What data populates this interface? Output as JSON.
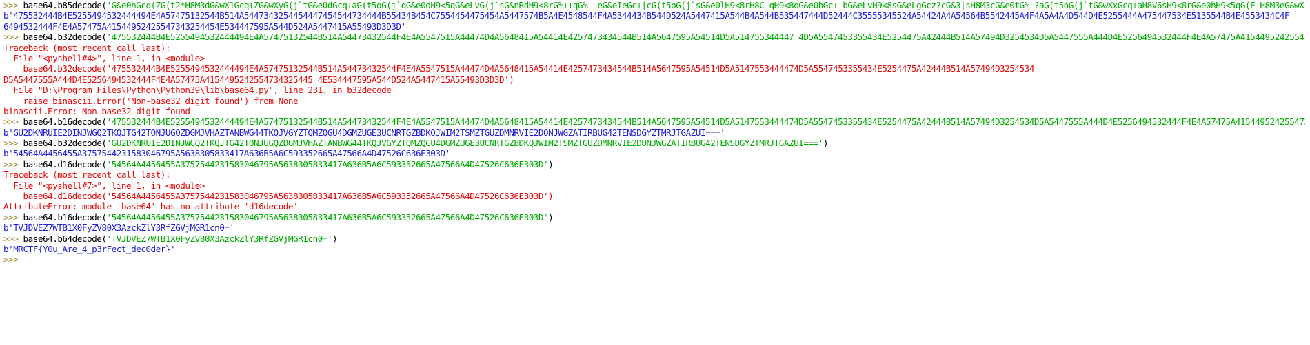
{
  "window": {
    "type": "python-idle-shell"
  },
  "colors": {
    "prompt": "#9e8a2c",
    "code": "#000000",
    "string": "#00aa00",
    "output": "#1f1fd4",
    "error": "#e10b0b",
    "background": "#ffffff"
  },
  "shell": {
    "prompt": ">>> ",
    "lines": [
      {
        "kind": "input",
        "code": "base64.b85decode(",
        "str": "'G&e0hGcq(ZG(t2*H8M3dG&wX1Gcq(ZG&wXyG(j`tG&e0dGcq+aG(t5oG(j`qG&e0dH9<5qG&eLvG(j`sG&nRdH9<8rG%++qG%__eG&eIeGc+|cG(t5oG(j`sG&e0lH9<8rH8C_qH9<8oG&e0hGc+_bG&eLvH9<8sG&eLgGcz?cG&3|sH8M3cG&e0tG%_?aG(t5oG(j`tG&wXxGcq+aH8V6sH9<8rG&e0hH9<5qG(E-H8M3eG&wX1Gcq(ZG)6Q<G(j`qG&e0tG%*<aG&wagG%__cG&eIeGcq+aG&M9uH8V6cG&e01H9<8rG(<HrG(j`qG&eLcH9<8sG&wUwGek2'",
        "close": ")"
      },
      {
        "kind": "output",
        "text": "b'475532444B4E5255494532444494E4A57475132544B514A5447343254454447454544734444B55434B454C7554454475454A5447574B5A4E4548544F4A5344434B544D524A5447415A544B4A544B535447444D52444C35555345524A54424A4A54564B5542445A4F4A5A4A4D544D4E5255444A475447534E5135544B4E4553434C4F"
      },
      {
        "kind": "output",
        "text": "6494532444F4E4A57475A41544952425547343254454E534447595A544D524A5447415A55493D3D3D'"
      },
      {
        "kind": "input",
        "code": "base64.b32decode(",
        "str": "'475532444B4E5255494532444494E4A57475132544B514A54473432544F4E4A5547515A44474D4A5648415A54414E4257473434544B514A5647595A54514D5A514755344447 4D5A5547453355434E5254475A42444B514A57494D3254534D5A5447555A444D4E5256494532444F4E4A57475A4154495242554734325445 4E534447595A544D524A5447415A55493D3D3D'",
        "close": ")"
      },
      {
        "kind": "error",
        "text": "Traceback (most recent call last):"
      },
      {
        "kind": "error",
        "text": "  File \"<pyshell#4>\", line 1, in <module>"
      },
      {
        "kind": "error",
        "text": "    base64.b32decode('475532444B4E5255494532444494E4A57475132544B514A54473432544F4E4A5547515A44474D4A5648415A54414E4257473434544B514A5647595A54514D5A5147553444474D5A5547453355434E5254475A42444B514A57494D3254534"
      },
      {
        "kind": "error",
        "text": "D5A5447555A444D4E5256494532444F4E4A57475A4154495242554734325445 4E534447595A544D524A5447415A55493D3D3D')"
      },
      {
        "kind": "error",
        "text": "  File \"D:\\Program Files\\Python\\Python39\\lib\\base64.py\", line 231, in b32decode"
      },
      {
        "kind": "error",
        "text": "    raise binascii.Error('Non-base32 digit found') from None"
      },
      {
        "kind": "error",
        "text": "binascii.Error: Non-base32 digit found"
      },
      {
        "kind": "input",
        "code": "base64.b16decode(",
        "str": "'475532444B4E5255494532444494E4A57475132544B514A54473432544F4E4A5547515A44474D4A5648415A54414E4257473434544B514A5647595A54514D5A5147553444474D5A5547453355434E5254475A42444B514A57494D3254534D5A5447555A444D4E5256494532444F4E4A57475A415449524255473432544554E534447595A544D524A5447415A55493D3D3D'",
        "close": ")"
      },
      {
        "kind": "output",
        "text": "b'GU2DKNRUIE2DINJWGQ2TKQJTG42TONJUGQZDGMJVHAZTANBWG44TKQJVGYZTQMZQGU4DGMZUGE3UCNRTGZBDKQJWIM2TSMZTGUZDMNRVIE2DONJWGZATIRBUG42TENSDGYZTMRJTGAZUI==='"
      },
      {
        "kind": "input",
        "code": "base64.b32decode(",
        "str": "'GU2DKNRUIE2DINJWGQ2TKQJTG42TONJUGQZDGMJVHAZTANBWG44TKQJVGYZTQMZQGU4DGMZUGE3UCNRTGZBDKQJWIM2TSMZTGUZDMNRVIE2DONJWGZATIRBUG42TENSDGYZTMRJTGAZUI==='",
        "close": ")"
      },
      {
        "kind": "output",
        "text": "b'54564A4456455A3757544231583046795A5638305833417A636B5A6C593352665A47566A4D47526C636E303D'"
      },
      {
        "kind": "input",
        "code": "base64.d16decode(",
        "str": "'54564A4456455A3757544231583046795A5638305833417A636B5A6C593352665A47566A4D47526C636E303D'",
        "close": ")"
      },
      {
        "kind": "error",
        "text": "Traceback (most recent call last):"
      },
      {
        "kind": "error",
        "text": "  File \"<pyshell#7>\", line 1, in <module>"
      },
      {
        "kind": "error",
        "text": "    base64.d16decode('54564A4456455A3757544231583046795A5638305833417A636B5A6C593352665A47566A4D47526C636E303D')"
      },
      {
        "kind": "error",
        "text": "AttributeError: module 'base64' has no attribute 'd16decode'"
      },
      {
        "kind": "input",
        "code": "base64.b16decode(",
        "str": "'54564A4456455A3757544231583046795A5638305833417A636B5A6C593352665A47566A4D47526C636E303D'",
        "close": ")"
      },
      {
        "kind": "output",
        "text": "b'TVJDVEZ7WTB1X0FyZV80X3AzckZlY3RfZGVjMGR1cn0='"
      },
      {
        "kind": "input",
        "code": "base64.b64decode(",
        "str": "'TVJDVEZ7WTB1X0FyZV80X3AzckZlY3RfZGVjMGR1cn0='",
        "close": ")"
      },
      {
        "kind": "output",
        "text": "b'MRCTF{Y0u_Are_4_p3rFect_dec0der}'"
      },
      {
        "kind": "prompt-only",
        "text": ""
      }
    ]
  }
}
